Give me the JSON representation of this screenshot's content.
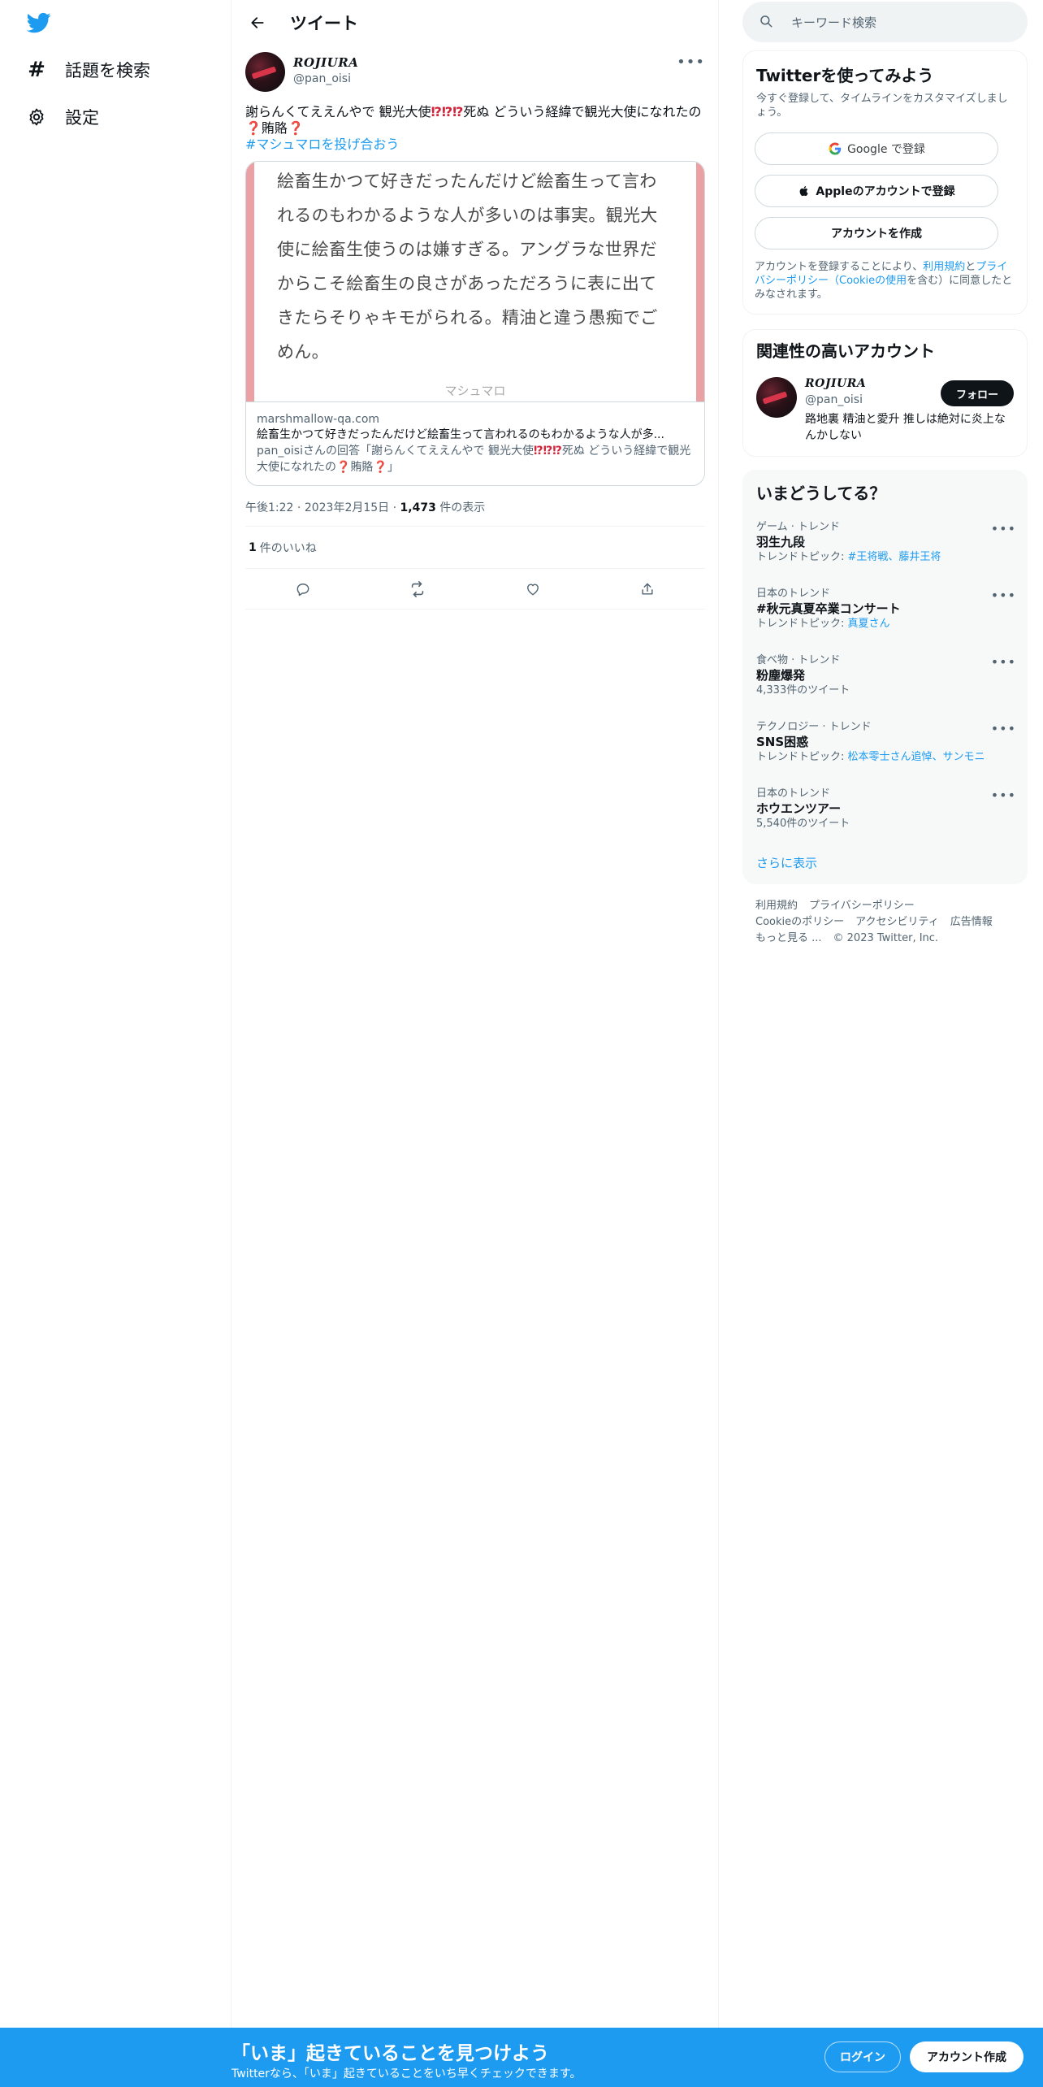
{
  "nav": {
    "explore_label": "話題を検索",
    "settings_label": "設定"
  },
  "header": {
    "title": "ツイート"
  },
  "tweet": {
    "author_name": "ROJIURA",
    "author_handle": "@pan_oisi",
    "text_part1": "謝らんくてええんやで 観光大使",
    "emoji_1": "⁉⁉⁉",
    "text_part2": "死ぬ どういう経緯で観光大使になれたの",
    "emoji_2": "❓",
    "text_part3": "賄賂",
    "emoji_3": "❓",
    "hashtag": "#マシュマロを投げ合おう",
    "card": {
      "media_text": "絵畜生かつて好きだったんだけど絵畜生って言われるのもわかるような人が多いのは事実。観光大使に絵畜生使うのは嫌すぎる。アングラな世界だからこそ絵畜生の良さがあっただろうに表に出てきたらそりゃキモがられる。精油と違う愚痴でごめん。",
      "media_footer": "マシュマロ",
      "domain": "marshmallow-qa.com",
      "title": "絵畜生かつて好きだったんだけど絵畜生って言われるのもわかるような人が多...",
      "desc_part1": "pan_oisiさんの回答「謝らんくてええんやで 観光大使",
      "desc_emoji_1": "⁉⁉⁉",
      "desc_part2": "死ぬ どういう経緯で観光大使になれたの",
      "desc_emoji_2": "❓",
      "desc_part3": "賄賂",
      "desc_emoji_3": "❓",
      "desc_part4": "」"
    },
    "time": "午後1:22",
    "date": "2023年2月15日",
    "views_count": "1,473",
    "views_label": " 件の表示",
    "likes_count": "1",
    "likes_label": "件のいいね"
  },
  "sidebar": {
    "search_placeholder": "キーワード検索",
    "signup": {
      "title": "Twitterを使ってみよう",
      "subtitle": "今すぐ登録して、タイムラインをカスタマイズしましょう。",
      "google_label": "Google で登録",
      "apple_label": "Appleのアカウントで登録",
      "create_label": "アカウントを作成",
      "terms_part1": "アカウントを登録することにより、",
      "terms_link1": "利用規約",
      "terms_part2": "と",
      "terms_link2": "プライバシーポリシー（Cookieの使用",
      "terms_part3": "を含む）に同意したとみなされます。"
    },
    "relevant": {
      "title": "関連性の高いアカウント",
      "name": "ROJIURA",
      "handle": "@pan_oisi",
      "bio": "路地裏 精油と愛升 推しは絶対に炎上なんかしない",
      "follow_label": "フォロー"
    },
    "trends": {
      "title": "いまどうしてる？",
      "items": [
        {
          "category": "ゲーム · トレンド",
          "name": "羽生九段",
          "meta_prefix": "トレンドトピック: ",
          "meta_link": "#王将戦、藤井王将"
        },
        {
          "category": "日本のトレンド",
          "name": "#秋元真夏卒業コンサート",
          "meta_prefix": "トレンドトピック: ",
          "meta_link": "真夏さん"
        },
        {
          "category": "食べ物 · トレンド",
          "name": "粉塵爆発",
          "meta_prefix": "4,333件のツイート",
          "meta_link": ""
        },
        {
          "category": "テクノロジー · トレンド",
          "name": "SNS困惑",
          "meta_prefix": "トレンドトピック: ",
          "meta_link": "松本零士さん追悼、サンモニ"
        },
        {
          "category": "日本のトレンド",
          "name": "ホウエンツアー",
          "meta_prefix": "5,540件のツイート",
          "meta_link": ""
        }
      ],
      "show_more": "さらに表示"
    },
    "footer": {
      "terms": "利用規約",
      "privacy": "プライバシーポリシー",
      "cookie": "Cookieのポリシー",
      "accessibility": "アクセシビリティ",
      "ads": "広告情報",
      "more": "もっと見る ...",
      "copyright": "© 2023 Twitter, Inc."
    }
  },
  "bottombar": {
    "title": "「いま」起きていることを見つけよう",
    "subtitle": "Twitterなら、「いま」起きていることをいち早くチェックできます。",
    "login_label": "ログイン",
    "signup_label": "アカウント作成"
  },
  "colors": {
    "accent": "#1d9bf0",
    "text": "#0f1419",
    "muted": "#536471",
    "card_border_pink": "#eba0a4"
  }
}
